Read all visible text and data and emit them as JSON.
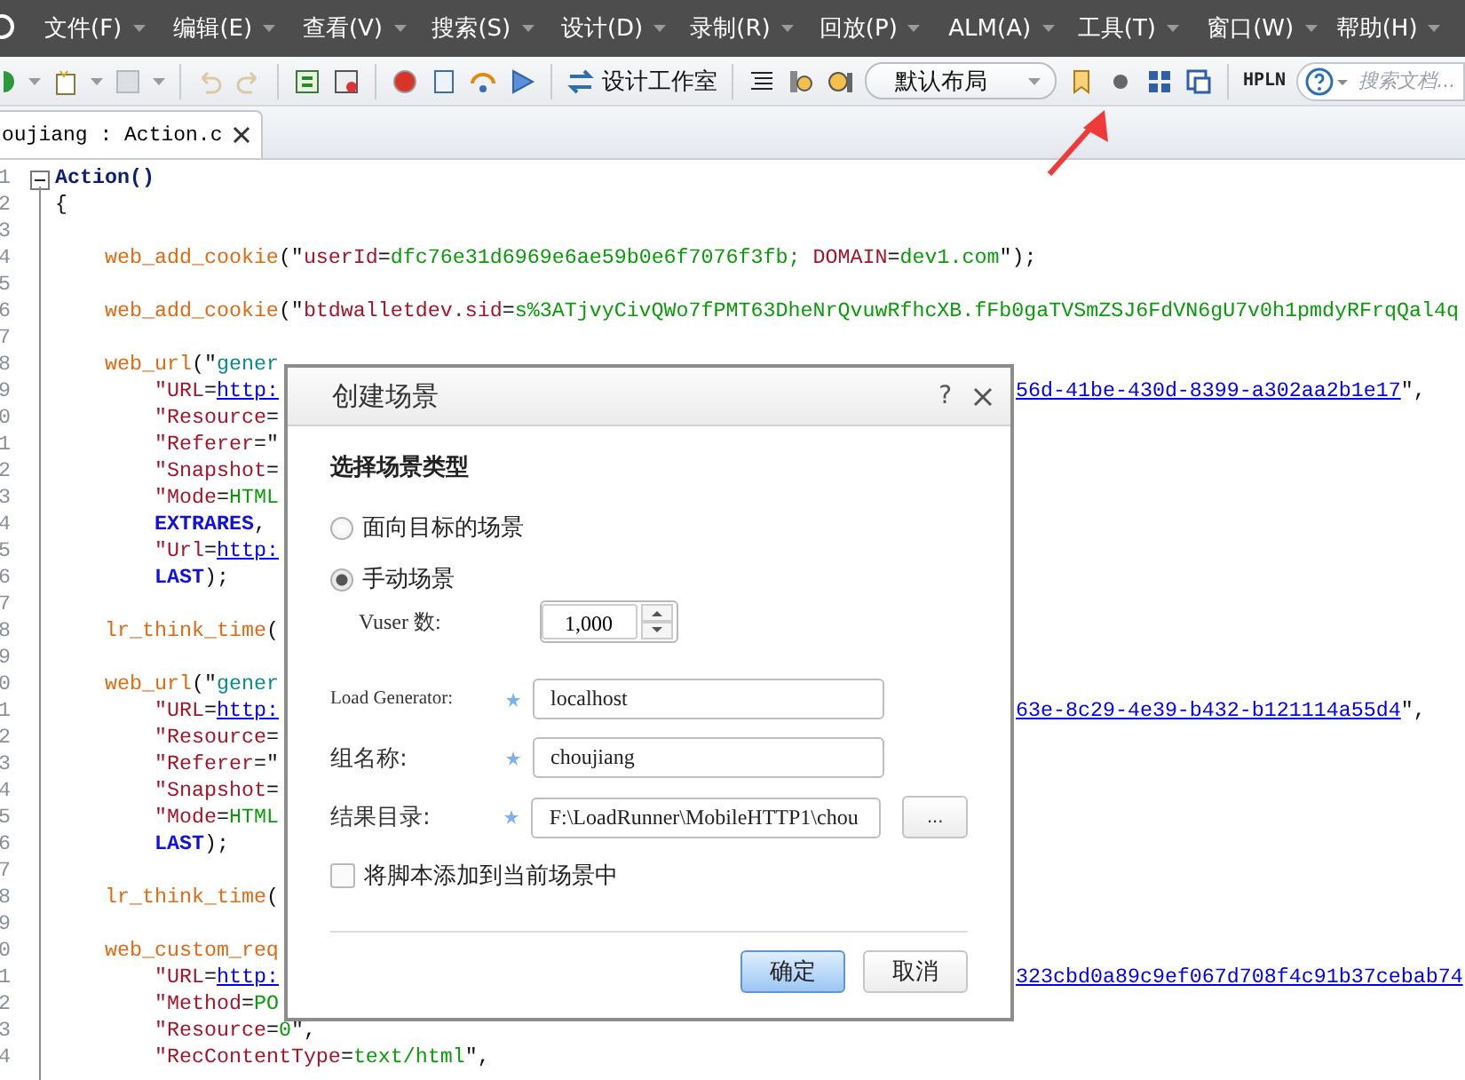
{
  "menu_bar": {
    "items": [
      {
        "label": "文件(F)"
      },
      {
        "label": "编辑(E)"
      },
      {
        "label": "查看(V)"
      },
      {
        "label": "搜索(S)"
      },
      {
        "label": "设计(D)"
      },
      {
        "label": "录制(R)"
      },
      {
        "label": "回放(P)"
      },
      {
        "label": "ALM(A)"
      },
      {
        "label": "工具(T)"
      },
      {
        "label": "窗口(W)"
      },
      {
        "label": "帮助(H)"
      }
    ]
  },
  "toolbar": {
    "studio_button": "设计工作室",
    "layout_select": "默认布局",
    "hpln_button": "HPLN",
    "search": {
      "placeholder": "搜索文档..."
    }
  },
  "tabs": [
    {
      "label": "oujiang : Action.c",
      "selected": true
    }
  ],
  "editor": {
    "lines": [
      {
        "number": "1",
        "kind": "header",
        "left": [
          {
            "kind": "title",
            "text": "Action()"
          }
        ]
      },
      {
        "number": "2",
        "kind": "header",
        "left": [
          {
            "kind": "punct",
            "text": "{"
          }
        ]
      },
      {
        "number": "3",
        "kind": "blank"
      },
      {
        "number": "4",
        "kind": "statement",
        "left": [
          {
            "kind": "func",
            "text": "web_add_cookie"
          },
          {
            "kind": "punct",
            "text": "(\""
          },
          {
            "kind": "key",
            "text": "userId"
          },
          {
            "kind": "punct",
            "text": "="
          },
          {
            "kind": "value",
            "text": "dfc76e31d6969e6ae59b0e6f7076f3fb; "
          },
          {
            "kind": "key",
            "text": "DOMAIN"
          },
          {
            "kind": "punct",
            "text": "="
          },
          {
            "kind": "value",
            "text": "dev1.com"
          },
          {
            "kind": "punct",
            "text": "\");"
          }
        ]
      },
      {
        "number": "5",
        "kind": "blank"
      },
      {
        "number": "6",
        "kind": "statement",
        "left": [
          {
            "kind": "func",
            "text": "web_add_cookie"
          },
          {
            "kind": "punct",
            "text": "(\""
          },
          {
            "kind": "key",
            "text": "btdwalletdev.sid"
          },
          {
            "kind": "punct",
            "text": "="
          },
          {
            "kind": "value",
            "text": "s%3ATjvyCivQWo7fPMT63DheNrQvuwRfhcXB.fFb0gaTVSmZSJ6FdVN6gU7v0h1pmdyRFrqQal4q"
          }
        ]
      },
      {
        "number": "7",
        "kind": "blank"
      },
      {
        "number": "8",
        "kind": "statement",
        "left": [
          {
            "kind": "func",
            "text": "web_url"
          },
          {
            "kind": "punct",
            "text": "(\""
          },
          {
            "kind": "string",
            "text": "gener"
          }
        ]
      },
      {
        "number": "9",
        "kind": "argument",
        "left": [
          {
            "kind": "key",
            "text": "\"URL"
          },
          {
            "kind": "punct",
            "text": "="
          },
          {
            "kind": "link",
            "text": "http:"
          }
        ],
        "right": [
          {
            "kind": "link",
            "text": "56d-41be-430d-8399-a302aa2b1e17"
          },
          {
            "kind": "punct",
            "text": "\","
          }
        ]
      },
      {
        "number": "0",
        "kind": "argument",
        "left": [
          {
            "kind": "key",
            "text": "\"Resource"
          },
          {
            "kind": "punct",
            "text": "="
          }
        ]
      },
      {
        "number": "1",
        "kind": "argument",
        "left": [
          {
            "kind": "key",
            "text": "\"Referer"
          },
          {
            "kind": "punct",
            "text": "=\""
          }
        ]
      },
      {
        "number": "2",
        "kind": "argument",
        "left": [
          {
            "kind": "key",
            "text": "\"Snapshot"
          },
          {
            "kind": "punct",
            "text": "="
          }
        ]
      },
      {
        "number": "3",
        "kind": "argument",
        "left": [
          {
            "kind": "key",
            "text": "\"Mode"
          },
          {
            "kind": "punct",
            "text": "="
          },
          {
            "kind": "value",
            "text": "HTML"
          }
        ]
      },
      {
        "number": "4",
        "kind": "argument",
        "left": [
          {
            "kind": "keyword",
            "text": "EXTRARES"
          },
          {
            "kind": "punct",
            "text": ","
          }
        ]
      },
      {
        "number": "5",
        "kind": "argument",
        "left": [
          {
            "kind": "key",
            "text": "\"Url"
          },
          {
            "kind": "punct",
            "text": "="
          },
          {
            "kind": "link",
            "text": "http:"
          }
        ]
      },
      {
        "number": "6",
        "kind": "argument",
        "left": [
          {
            "kind": "keyword",
            "text": "LAST"
          },
          {
            "kind": "punct",
            "text": ");"
          }
        ]
      },
      {
        "number": "7",
        "kind": "blank"
      },
      {
        "number": "8",
        "kind": "statement",
        "left": [
          {
            "kind": "func",
            "text": "lr_think_time"
          },
          {
            "kind": "punct",
            "text": "("
          }
        ]
      },
      {
        "number": "9",
        "kind": "blank"
      },
      {
        "number": "0",
        "kind": "statement",
        "left": [
          {
            "kind": "func",
            "text": "web_url"
          },
          {
            "kind": "punct",
            "text": "(\""
          },
          {
            "kind": "string",
            "text": "gener"
          }
        ]
      },
      {
        "number": "1",
        "kind": "argument",
        "left": [
          {
            "kind": "key",
            "text": "\"URL"
          },
          {
            "kind": "punct",
            "text": "="
          },
          {
            "kind": "link",
            "text": "http:"
          }
        ],
        "right": [
          {
            "kind": "link",
            "text": "63e-8c29-4e39-b432-b121114a55d4"
          },
          {
            "kind": "punct",
            "text": "\","
          }
        ]
      },
      {
        "number": "2",
        "kind": "argument",
        "left": [
          {
            "kind": "key",
            "text": "\"Resource"
          },
          {
            "kind": "punct",
            "text": "="
          }
        ]
      },
      {
        "number": "3",
        "kind": "argument",
        "left": [
          {
            "kind": "key",
            "text": "\"Referer"
          },
          {
            "kind": "punct",
            "text": "=\""
          }
        ]
      },
      {
        "number": "4",
        "kind": "argument",
        "left": [
          {
            "kind": "key",
            "text": "\"Snapshot"
          },
          {
            "kind": "punct",
            "text": "="
          }
        ]
      },
      {
        "number": "5",
        "kind": "argument",
        "left": [
          {
            "kind": "key",
            "text": "\"Mode"
          },
          {
            "kind": "punct",
            "text": "="
          },
          {
            "kind": "value",
            "text": "HTML"
          }
        ]
      },
      {
        "number": "6",
        "kind": "argument",
        "left": [
          {
            "kind": "keyword",
            "text": "LAST"
          },
          {
            "kind": "punct",
            "text": ");"
          }
        ]
      },
      {
        "number": "7",
        "kind": "blank"
      },
      {
        "number": "8",
        "kind": "statement",
        "left": [
          {
            "kind": "func",
            "text": "lr_think_time"
          },
          {
            "kind": "punct",
            "text": "("
          }
        ]
      },
      {
        "number": "9",
        "kind": "blank"
      },
      {
        "number": "0",
        "kind": "statement",
        "left": [
          {
            "kind": "func",
            "text": "web_custom_req"
          }
        ]
      },
      {
        "number": "1",
        "kind": "argument",
        "left": [
          {
            "kind": "key",
            "text": "\"URL"
          },
          {
            "kind": "punct",
            "text": "="
          },
          {
            "kind": "link",
            "text": "http:"
          }
        ],
        "right": [
          {
            "kind": "link",
            "text": "323cbd0a89c9ef067d708f4c91b37cebab74"
          }
        ]
      },
      {
        "number": "2",
        "kind": "argument",
        "left": [
          {
            "kind": "key",
            "text": "\"Method"
          },
          {
            "kind": "punct",
            "text": "="
          },
          {
            "kind": "value",
            "text": "PO"
          }
        ]
      },
      {
        "number": "3",
        "kind": "argument",
        "left": [
          {
            "kind": "key",
            "text": "\"Resource"
          },
          {
            "kind": "punct",
            "text": "="
          },
          {
            "kind": "value",
            "text": "0"
          },
          {
            "kind": "punct",
            "text": "\","
          }
        ]
      },
      {
        "number": "4",
        "kind": "argument",
        "left": [
          {
            "kind": "key",
            "text": "\"RecContentType"
          },
          {
            "kind": "punct",
            "text": "="
          },
          {
            "kind": "value",
            "text": "text/html"
          },
          {
            "kind": "punct",
            "text": "\","
          }
        ]
      }
    ]
  },
  "dialog": {
    "title": "创建场景",
    "help": "?",
    "section": "选择场景类型",
    "scenario_types": [
      {
        "label": "面向目标的场景",
        "selected": false
      },
      {
        "label": "手动场景",
        "selected": true
      }
    ],
    "vuser": {
      "label": "Vuser 数:",
      "value": "1,000"
    },
    "fields": [
      {
        "label": "Load Generator:",
        "required": true,
        "value": "localhost",
        "browse": false
      },
      {
        "label": "组名称:",
        "required": true,
        "value": "choujiang",
        "browse": false
      },
      {
        "label": "结果目录:",
        "required": true,
        "value": "F:\\LoadRunner\\MobileHTTP1\\chou",
        "browse": true,
        "browse_label": "..."
      }
    ],
    "add_to_scenario": {
      "label": "将脚本添加到当前场景中",
      "checked": false
    },
    "buttons": [
      {
        "label": "确定",
        "primary": true
      },
      {
        "label": "取消",
        "primary": false
      }
    ]
  }
}
